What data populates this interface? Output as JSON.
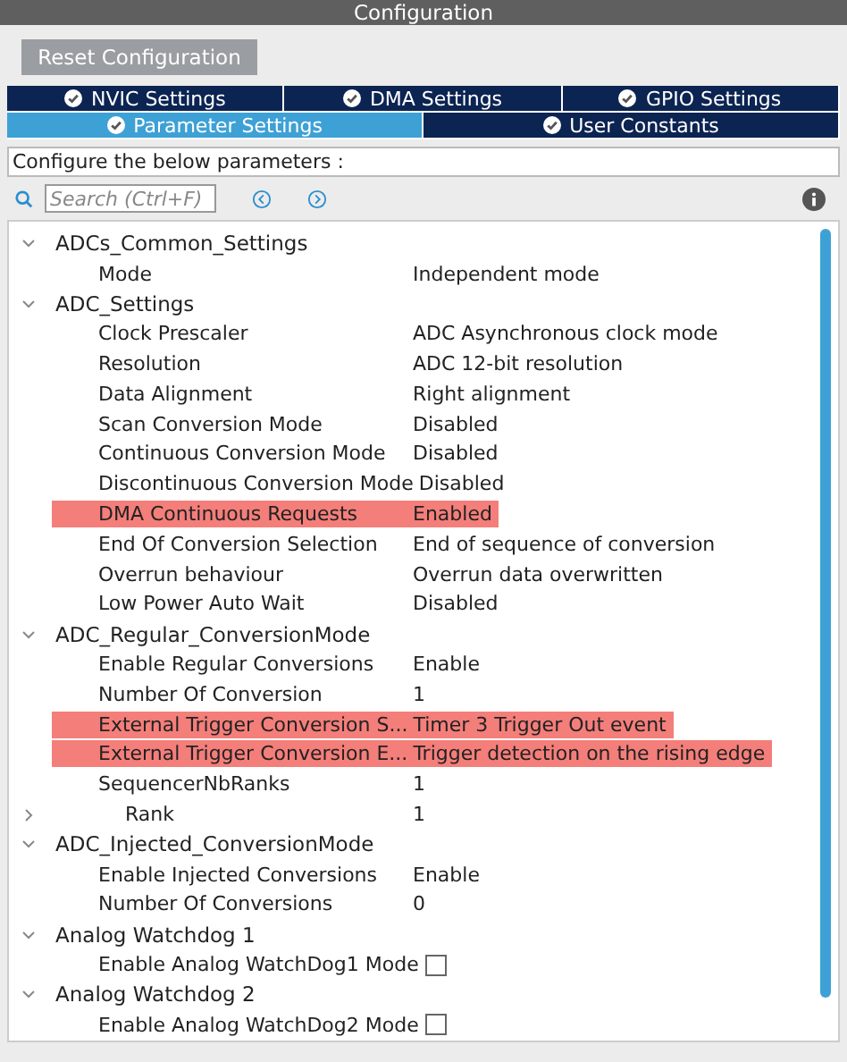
{
  "window": {
    "title": "Configuration"
  },
  "reset_button": "Reset Configuration",
  "tab_rows": [
    [
      {
        "label": "NVIC Settings",
        "selected": false
      },
      {
        "label": "DMA Settings",
        "selected": false
      },
      {
        "label": "GPIO Settings",
        "selected": false
      }
    ],
    [
      {
        "label": "Parameter Settings",
        "selected": true
      },
      {
        "label": "User Constants",
        "selected": false
      }
    ]
  ],
  "description": "Configure the below parameters :",
  "search": {
    "placeholder": "Search (Ctrl+F)"
  },
  "groups": [
    {
      "name": "ADCs_Common_Settings",
      "expanded": true,
      "items": [
        {
          "kind": "value",
          "name": "Mode",
          "value": "Independent mode",
          "highlighted": false
        }
      ]
    },
    {
      "name": "ADC_Settings",
      "expanded": true,
      "items": [
        {
          "kind": "value",
          "name": "Clock Prescaler",
          "value": "ADC Asynchronous clock mode",
          "highlighted": false
        },
        {
          "kind": "value",
          "name": "Resolution",
          "value": "ADC 12-bit resolution",
          "highlighted": false
        },
        {
          "kind": "value",
          "name": "Data Alignment",
          "value": "Right alignment",
          "highlighted": false
        },
        {
          "kind": "value",
          "name": "Scan Conversion Mode",
          "value": "Disabled",
          "highlighted": false
        },
        {
          "kind": "value",
          "name": "Continuous Conversion Mode",
          "value": "Disabled",
          "highlighted": false
        },
        {
          "kind": "value",
          "name": "Discontinuous Conversion Mode",
          "value": "Disabled",
          "highlighted": false
        },
        {
          "kind": "value",
          "name": "DMA Continuous Requests",
          "value": "Enabled",
          "highlighted": true
        },
        {
          "kind": "value",
          "name": "End Of Conversion Selection",
          "value": "End of sequence of conversion",
          "highlighted": false
        },
        {
          "kind": "value",
          "name": "Overrun behaviour",
          "value": "Overrun data overwritten",
          "highlighted": false
        },
        {
          "kind": "value",
          "name": "Low Power Auto Wait",
          "value": "Disabled",
          "highlighted": false
        }
      ]
    },
    {
      "name": "ADC_Regular_ConversionMode",
      "expanded": true,
      "items": [
        {
          "kind": "value",
          "name": "Enable Regular Conversions",
          "value": "Enable",
          "highlighted": false
        },
        {
          "kind": "value",
          "name": "Number Of Conversion",
          "value": "1",
          "highlighted": false
        },
        {
          "kind": "value",
          "name": "External Trigger Conversion S...",
          "value": "Timer 3 Trigger Out event",
          "highlighted": true
        },
        {
          "kind": "value",
          "name": "External Trigger Conversion E...",
          "value": "Trigger detection on the rising edge",
          "highlighted": true
        },
        {
          "kind": "value",
          "name": "SequencerNbRanks",
          "value": "1",
          "highlighted": false
        },
        {
          "kind": "subgroup",
          "name": "Rank",
          "value": "1",
          "highlighted": false,
          "expanded": false
        }
      ]
    },
    {
      "name": "ADC_Injected_ConversionMode",
      "expanded": true,
      "items": [
        {
          "kind": "value",
          "name": "Enable Injected Conversions",
          "value": "Enable",
          "highlighted": false
        },
        {
          "kind": "value",
          "name": "Number Of Conversions",
          "value": "0",
          "highlighted": false
        }
      ]
    },
    {
      "name": "Analog Watchdog 1",
      "expanded": true,
      "items": [
        {
          "kind": "checkbox",
          "name": "Enable Analog WatchDog1 Mode",
          "checked": false,
          "highlighted": false
        }
      ]
    },
    {
      "name": "Analog Watchdog 2",
      "expanded": true,
      "items": [
        {
          "kind": "checkbox",
          "name": "Enable Analog WatchDog2 Mode",
          "checked": false,
          "highlighted": false
        }
      ]
    }
  ]
}
